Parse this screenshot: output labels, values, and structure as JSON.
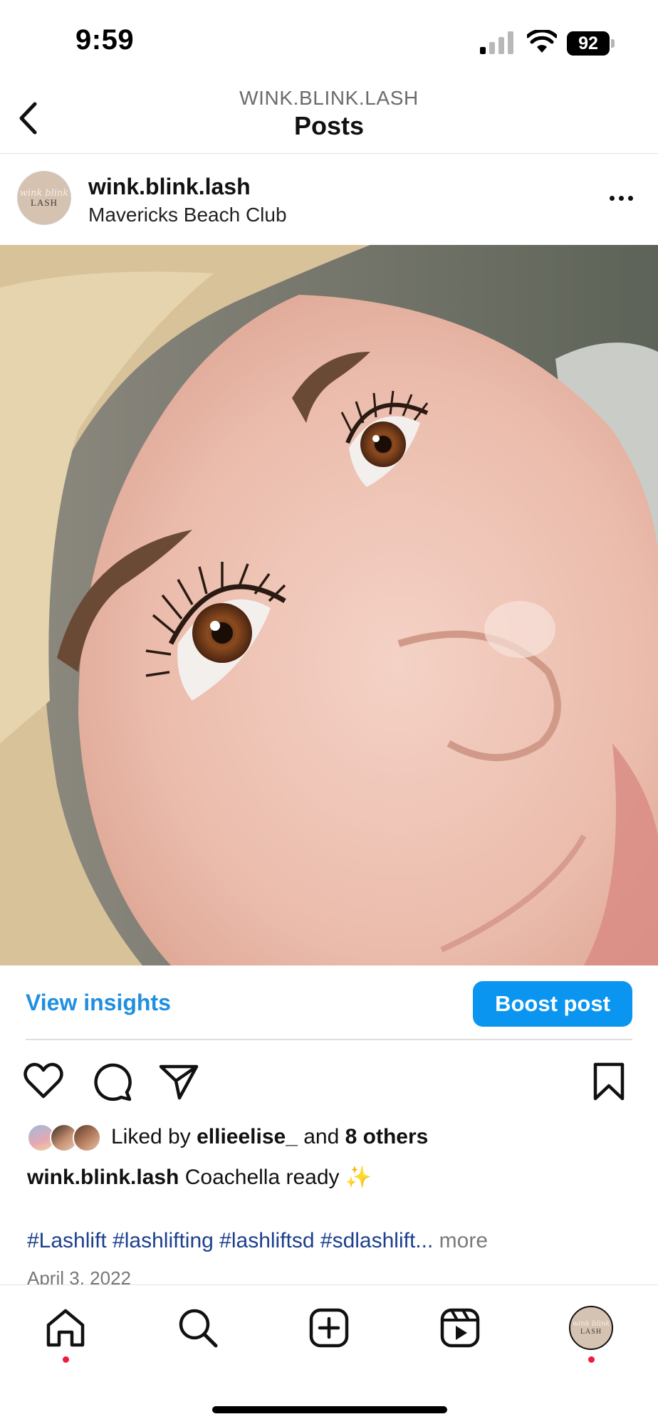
{
  "status_bar": {
    "time": "9:59",
    "battery": "92"
  },
  "header": {
    "account": "WINK.BLINK.LASH",
    "title": "Posts"
  },
  "post": {
    "avatar_text_script": "wink blink",
    "avatar_text_word": "LASH",
    "username": "wink.blink.lash",
    "location": "Mavericks Beach Club",
    "view_insights_label": "View insights",
    "boost_label": "Boost post",
    "likes_prefix": "Liked by",
    "liked_by_user": "ellieelise_",
    "likes_and": "and",
    "likes_others": "8 others",
    "caption_user": "wink.blink.lash",
    "caption_text": "Coachella ready ✨",
    "hashtags": "#Lashlift #lashlifting #lashliftsd #sdlashlift...",
    "more_label": "more",
    "date": "April 3, 2022"
  },
  "icons": {
    "back": "chevron-left-icon",
    "more": "more-horizontal-icon",
    "like": "heart-icon",
    "comment": "comment-icon",
    "share": "send-icon",
    "save": "bookmark-icon",
    "home": "home-icon",
    "search": "search-icon",
    "create": "plus-square-icon",
    "reels": "reels-icon",
    "profile": "profile-avatar"
  },
  "colors": {
    "accent_blue": "#0a95f0",
    "link_blue": "#1f8fe0",
    "hashtag_blue": "#1c3f8f",
    "notification_dot": "#f3193c"
  }
}
